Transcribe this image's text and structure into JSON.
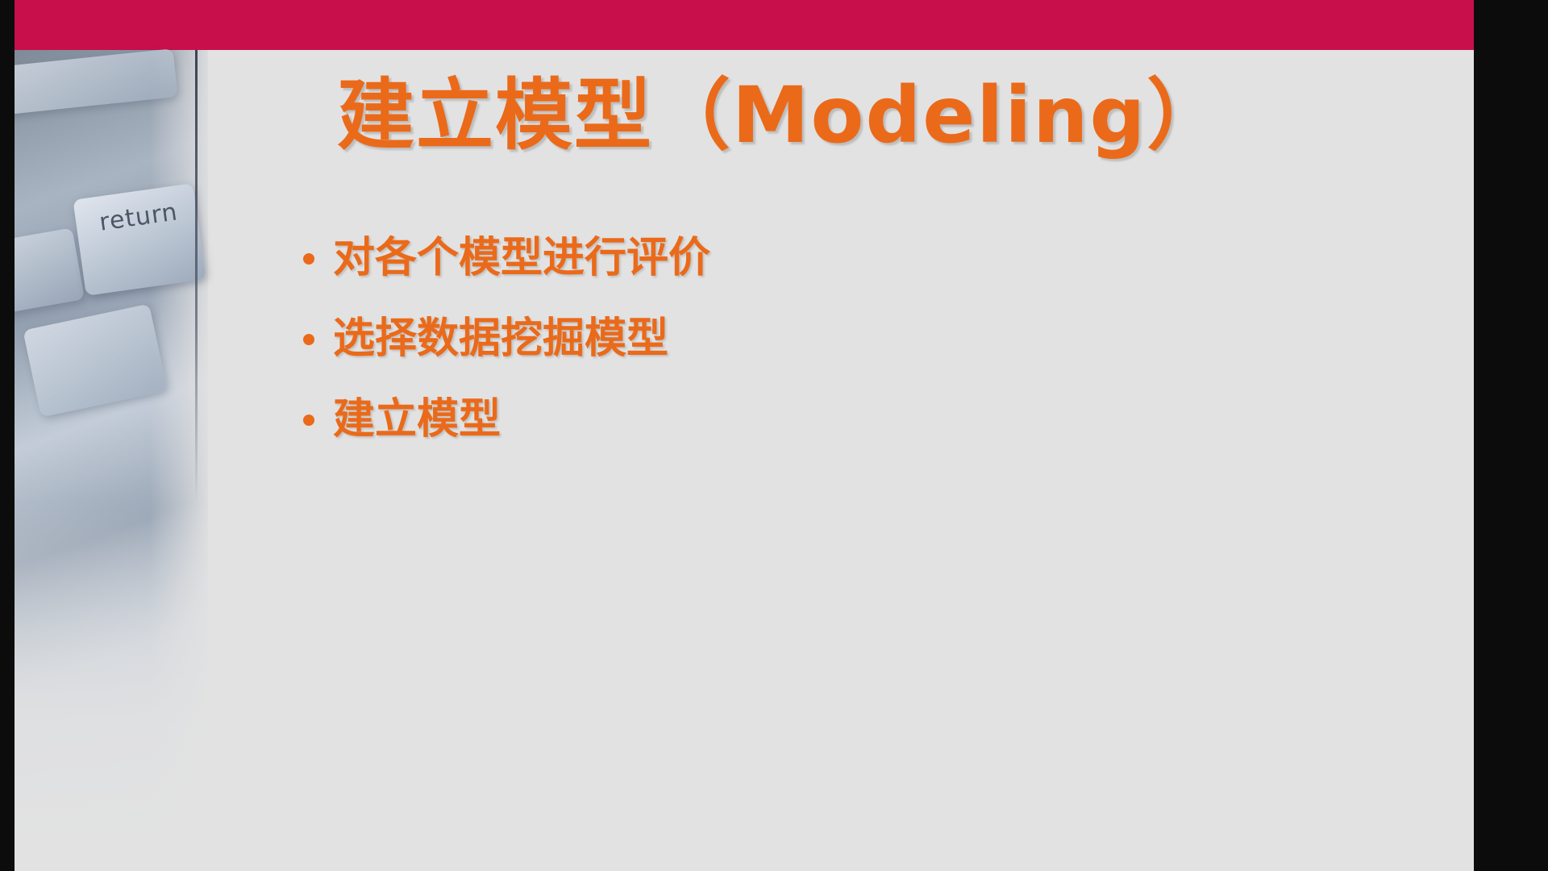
{
  "slide": {
    "title": "建立模型（Modeling）",
    "bullets": [
      "对各个模型进行评价",
      "选择数据挖掘模型",
      "建立模型"
    ],
    "decoration_label": "return"
  },
  "colors": {
    "accent_bar": "#c80f4c",
    "text_orange": "#ea6a1a",
    "slide_background": "#e2e2e2",
    "screen_background": "#0c0c0c"
  }
}
